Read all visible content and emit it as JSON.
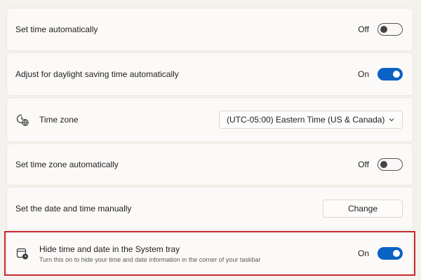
{
  "settings": {
    "auto_time": {
      "label": "Set time automatically",
      "state": "Off"
    },
    "dst": {
      "label": "Adjust for daylight saving time automatically",
      "state": "On"
    },
    "timezone": {
      "label": "Time zone",
      "value": "(UTC-05:00) Eastern Time (US & Canada)"
    },
    "auto_timezone": {
      "label": "Set time zone automatically",
      "state": "Off"
    },
    "manual": {
      "label": "Set the date and time manually",
      "button": "Change"
    },
    "hide_tray": {
      "label": "Hide time and date in the System tray",
      "description": "Turn this on to hide your time and date information in the corner of your taskbar",
      "state": "On"
    }
  },
  "colors": {
    "accent": "#0a62c4",
    "highlight": "#c62a32"
  },
  "icons": {
    "timezone": "globe-clock-icon",
    "hide_tray": "calendar-clock-icon",
    "dropdown": "chevron-down-icon"
  }
}
